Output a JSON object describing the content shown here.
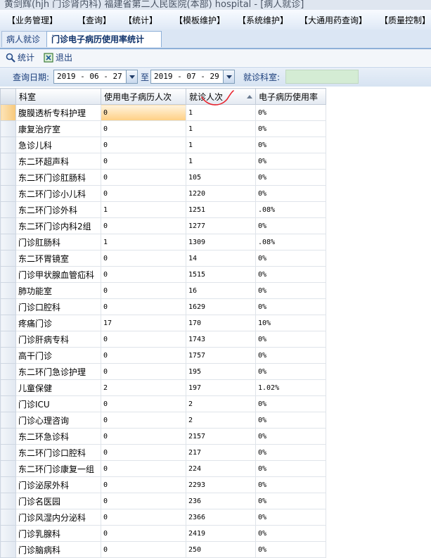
{
  "window": {
    "title": "黄剑辉(hjh 门诊肾内科) 福建省第二人民医院(本部) hospital - [病人就诊]"
  },
  "menu": [
    "【业务管理】",
    "【查询】",
    "【统计】",
    "【模板维护】",
    "【系统维护】",
    "【大通用药查询】",
    "【质量控制】"
  ],
  "tabs": {
    "inactive": "病人就诊",
    "active": "门诊电子病历使用率统计"
  },
  "toolbar": {
    "stat_label": "统计",
    "exit_label": "退出"
  },
  "query": {
    "date_label": "查询日期:",
    "start_date": "2019 - 06 - 27",
    "to_label": "至",
    "end_date": "2019 - 07 - 29",
    "dept_label": "就诊科室:",
    "dept_value": ""
  },
  "grid": {
    "columns": [
      "科室",
      "使用电子病历人次",
      "就诊人次",
      "电子病历使用率"
    ],
    "sorted_column": "就诊人次",
    "rows": [
      {
        "dept": "腹膜透析专科护理",
        "used": "0",
        "visits": "1",
        "rate": "0%"
      },
      {
        "dept": "康复治疗室",
        "used": "0",
        "visits": "1",
        "rate": "0%"
      },
      {
        "dept": "急诊儿科",
        "used": "0",
        "visits": "1",
        "rate": "0%"
      },
      {
        "dept": "东二环超声科",
        "used": "0",
        "visits": "1",
        "rate": "0%"
      },
      {
        "dept": "东二环门诊肛肠科",
        "used": "0",
        "visits": "105",
        "rate": "0%"
      },
      {
        "dept": "东二环门诊小儿科",
        "used": "0",
        "visits": "1220",
        "rate": "0%"
      },
      {
        "dept": "东二环门诊外科",
        "used": "1",
        "visits": "1251",
        "rate": ".08%"
      },
      {
        "dept": "东二环门诊内科2组",
        "used": "0",
        "visits": "1277",
        "rate": "0%"
      },
      {
        "dept": "门诊肛肠科",
        "used": "1",
        "visits": "1309",
        "rate": ".08%"
      },
      {
        "dept": "东二环胃镜室",
        "used": "0",
        "visits": "14",
        "rate": "0%"
      },
      {
        "dept": "门诊甲状腺血管疝科",
        "used": "0",
        "visits": "1515",
        "rate": "0%"
      },
      {
        "dept": "肺功能室",
        "used": "0",
        "visits": "16",
        "rate": "0%"
      },
      {
        "dept": "门诊口腔科",
        "used": "0",
        "visits": "1629",
        "rate": "0%"
      },
      {
        "dept": "疼痛门诊",
        "used": "17",
        "visits": "170",
        "rate": "10%"
      },
      {
        "dept": "门诊肝病专科",
        "used": "0",
        "visits": "1743",
        "rate": "0%"
      },
      {
        "dept": "高干门诊",
        "used": "0",
        "visits": "1757",
        "rate": "0%"
      },
      {
        "dept": "东二环门急诊护理",
        "used": "0",
        "visits": "195",
        "rate": "0%"
      },
      {
        "dept": "儿童保健",
        "used": "2",
        "visits": "197",
        "rate": "1.02%"
      },
      {
        "dept": "门诊ICU",
        "used": "0",
        "visits": "2",
        "rate": "0%"
      },
      {
        "dept": "门诊心理咨询",
        "used": "0",
        "visits": "2",
        "rate": "0%"
      },
      {
        "dept": "东二环急诊科",
        "used": "0",
        "visits": "2157",
        "rate": "0%"
      },
      {
        "dept": "东二环门诊口腔科",
        "used": "0",
        "visits": "217",
        "rate": "0%"
      },
      {
        "dept": "东二环门诊康复一组",
        "used": "0",
        "visits": "224",
        "rate": "0%"
      },
      {
        "dept": "门诊泌尿外科",
        "used": "0",
        "visits": "2293",
        "rate": "0%"
      },
      {
        "dept": "门诊名医园",
        "used": "0",
        "visits": "236",
        "rate": "0%"
      },
      {
        "dept": "门诊风湿内分泌科",
        "used": "0",
        "visits": "2366",
        "rate": "0%"
      },
      {
        "dept": "门诊乳腺科",
        "used": "0",
        "visits": "2419",
        "rate": "0%"
      },
      {
        "dept": "门诊脑病科",
        "used": "0",
        "visits": "250",
        "rate": "0%"
      }
    ]
  },
  "colors": {
    "accent": "#1a3d7a",
    "selected": "#ffcf83",
    "dept_field": "#d4ecd4",
    "annotation": "#e8202a"
  },
  "icons": {
    "stat": "magnifier-icon",
    "exit": "exit-icon"
  }
}
